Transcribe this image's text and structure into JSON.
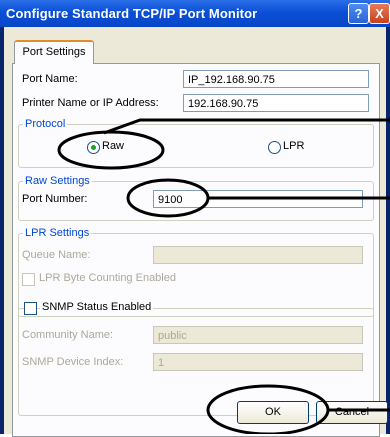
{
  "window": {
    "title": "Configure Standard TCP/IP Port Monitor",
    "help_label": "?",
    "close_label": "X"
  },
  "tab": {
    "label": "Port Settings"
  },
  "port_name": {
    "label": "Port Name:",
    "value": "IP_192.168.90.75"
  },
  "printer_address": {
    "label": "Printer Name or IP Address:",
    "value": "192.168.90.75"
  },
  "protocol": {
    "legend": "Protocol",
    "raw_label": "Raw",
    "lpr_label": "LPR",
    "selected": "Raw"
  },
  "raw_settings": {
    "legend": "Raw Settings",
    "port_number_label": "Port Number:",
    "port_number_value": "9100"
  },
  "lpr_settings": {
    "legend": "LPR Settings",
    "queue_name_label": "Queue Name:",
    "queue_name_value": "",
    "byte_counting_label": "LPR Byte Counting Enabled"
  },
  "snmp": {
    "legend": "SNMP Status Enabled",
    "community_label": "Community Name:",
    "community_value": "public",
    "device_index_label": "SNMP Device Index:",
    "device_index_value": "1"
  },
  "buttons": {
    "ok": "OK",
    "cancel": "Cancel"
  }
}
